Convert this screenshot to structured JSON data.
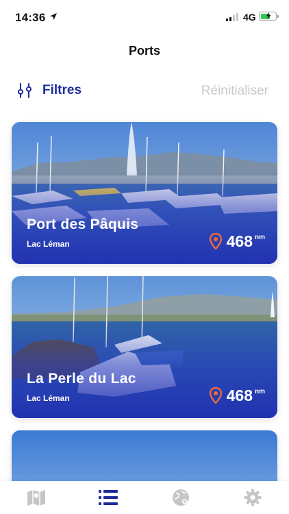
{
  "status_bar": {
    "time": "14:36",
    "network": "4G",
    "signal_bars_active": 2,
    "battery_level": 0.55,
    "colors": {
      "battery_fill": "#35c759"
    }
  },
  "header": {
    "title": "Ports",
    "filters_label": "Filtres",
    "reset_label": "Réinitialiser"
  },
  "colors": {
    "accent": "#1d2b9c",
    "disabled_text": "#c8c8cc",
    "pin": "#ef6a35",
    "card_overlay": "#1f2cb2"
  },
  "ports": [
    {
      "name": "Port des Pâquis",
      "lake": "Lac Léman",
      "distance": "468",
      "unit": "nm",
      "icon": "location-pin-icon"
    },
    {
      "name": "La Perle du Lac",
      "lake": "Lac Léman",
      "distance": "468",
      "unit": "nm",
      "icon": "location-pin-icon"
    }
  ],
  "tab_bar": {
    "tabs": [
      {
        "icon": "map-icon",
        "active": false
      },
      {
        "icon": "list-icon",
        "active": true
      },
      {
        "icon": "globe-icon",
        "active": false
      },
      {
        "icon": "gear-icon",
        "active": false
      }
    ]
  }
}
